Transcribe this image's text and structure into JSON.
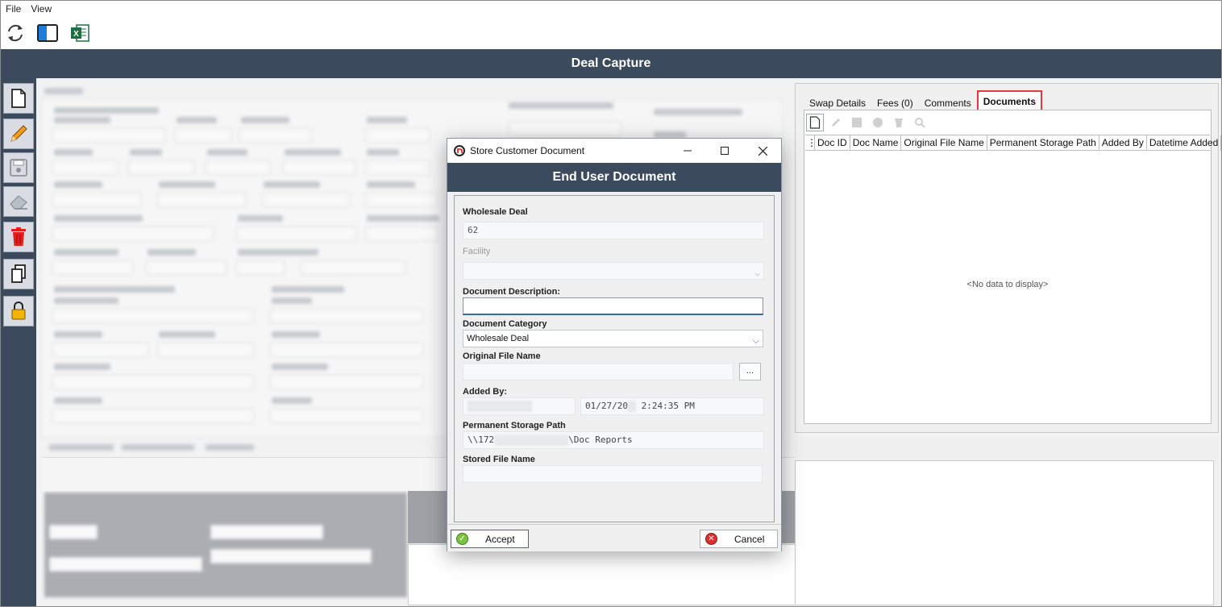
{
  "menu": {
    "file": "File",
    "view": "View"
  },
  "toolbar": {
    "icons": [
      "refresh-icon",
      "layout-panel-icon",
      "excel-icon"
    ]
  },
  "app_title": "Deal Capture",
  "left_toolbar": [
    "new-document-icon",
    "edit-pencil-icon",
    "save-icon",
    "eraser-icon",
    "delete-trash-icon",
    "copy-icon",
    "lock-icon"
  ],
  "right_panel": {
    "tabs": [
      "Swap Details",
      "Fees (0)",
      "Comments",
      "Documents"
    ],
    "active_tab": "Documents",
    "grid_columns": [
      "Doc ID",
      "Doc Name",
      "Original File Name",
      "Permanent Storage Path",
      "Added By",
      "Datetime Added"
    ],
    "empty_text": "<No data to display>"
  },
  "dialog": {
    "window_title": "Store Customer Document",
    "header": "End User Document",
    "fields": {
      "wholesale_deal_label": "Wholesale Deal",
      "wholesale_deal_value": "62",
      "facility_label": "Facility",
      "facility_value": "",
      "doc_description_label": "Document Description:",
      "doc_description_value": "",
      "doc_category_label": "Document Category",
      "doc_category_value": "Wholesale Deal",
      "original_file_label": "Original File Name",
      "original_file_value": "",
      "browse_label": "...",
      "added_by_label": "Added By:",
      "added_date_prefix": "01/27/20",
      "added_time": "2:24:35 PM",
      "storage_path_label": "Permanent Storage Path",
      "storage_path_prefix": "\\\\172",
      "storage_path_suffix": "\\Doc Reports",
      "stored_file_label": "Stored File Name",
      "stored_file_value": ""
    },
    "accept_label": "Accept",
    "cancel_label": "Cancel"
  },
  "colors": {
    "title_bar": "#3c4a5e",
    "active_tab_outline": "#e03a3a",
    "accept_icon": "#7cc242",
    "cancel_icon": "#d9302e",
    "delete_icon": "#e02020",
    "lock_icon": "#f2b400"
  }
}
